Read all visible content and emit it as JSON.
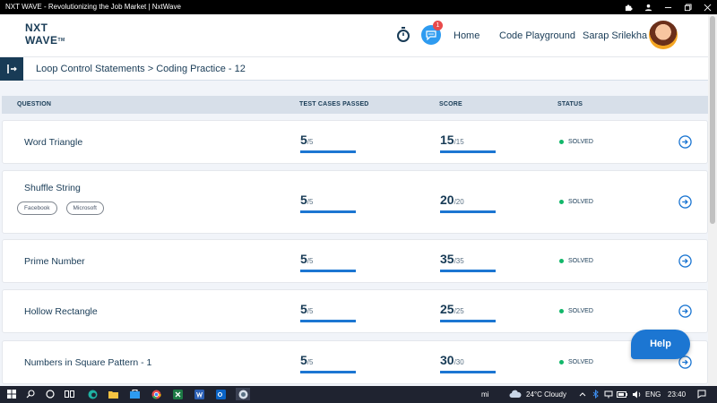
{
  "window": {
    "title": "NXT WAVE - Revolutionizing the Job Market | NxtWave",
    "icons": [
      "puzzle-icon",
      "minimize-icon",
      "restore-icon",
      "close-icon"
    ]
  },
  "header": {
    "logo_line1": "NXT",
    "logo_line2": "WAVE",
    "logo_tm": "TM",
    "chat_badge": "1",
    "nav_home": "Home",
    "nav_playground": "Code Playground",
    "user_name": "Sarap Srilekha"
  },
  "breadcrumb": "Loop Control Statements > Coding Practice - 12",
  "table": {
    "headers": {
      "question": "QUESTION",
      "tests": "TEST CASES PASSED",
      "score": "SCORE",
      "status": "STATUS"
    },
    "rows": [
      {
        "question": "Word Triangle",
        "tags": [],
        "tests_passed": "5",
        "tests_total": "/5",
        "tests_progress": 1.0,
        "score": "15",
        "score_total": "/15",
        "score_progress": 1.0,
        "status": "SOLVED"
      },
      {
        "question": "Shuffle String",
        "tags": [
          "Facebook",
          "Microsoft"
        ],
        "tests_passed": "5",
        "tests_total": "/5",
        "tests_progress": 1.0,
        "score": "20",
        "score_total": "/20",
        "score_progress": 1.0,
        "status": "SOLVED"
      },
      {
        "question": "Prime Number",
        "tags": [],
        "tests_passed": "5",
        "tests_total": "/5",
        "tests_progress": 1.0,
        "score": "35",
        "score_total": "/35",
        "score_progress": 1.0,
        "status": "SOLVED"
      },
      {
        "question": "Hollow Rectangle",
        "tags": [],
        "tests_passed": "5",
        "tests_total": "/5",
        "tests_progress": 1.0,
        "score": "25",
        "score_total": "/25",
        "score_progress": 1.0,
        "status": "SOLVED"
      },
      {
        "question": "Numbers in Square Pattern - 1",
        "tags": [],
        "tests_passed": "5",
        "tests_total": "/5",
        "tests_progress": 1.0,
        "score": "30",
        "score_total": "/30",
        "score_progress": 1.0,
        "status": "SOLVED"
      }
    ]
  },
  "help_label": "Help",
  "taskbar": {
    "weather": "24°C  Cloudy",
    "language": "ENG",
    "time": "23:40",
    "mi_label": "mi",
    "apps": [
      "windows-icon",
      "search-icon",
      "cortana-icon",
      "task-view-icon",
      "edge-icon",
      "file-explorer-icon",
      "store-icon",
      "chrome-icon",
      "excel-icon",
      "word-icon",
      "outlook-icon",
      "browser-app-icon"
    ]
  },
  "colors": {
    "primary": "#183b56",
    "accent": "#1c76d2",
    "success": "#12b76a",
    "header_row": "#d7dfe9",
    "background": "#f1f4f9"
  }
}
